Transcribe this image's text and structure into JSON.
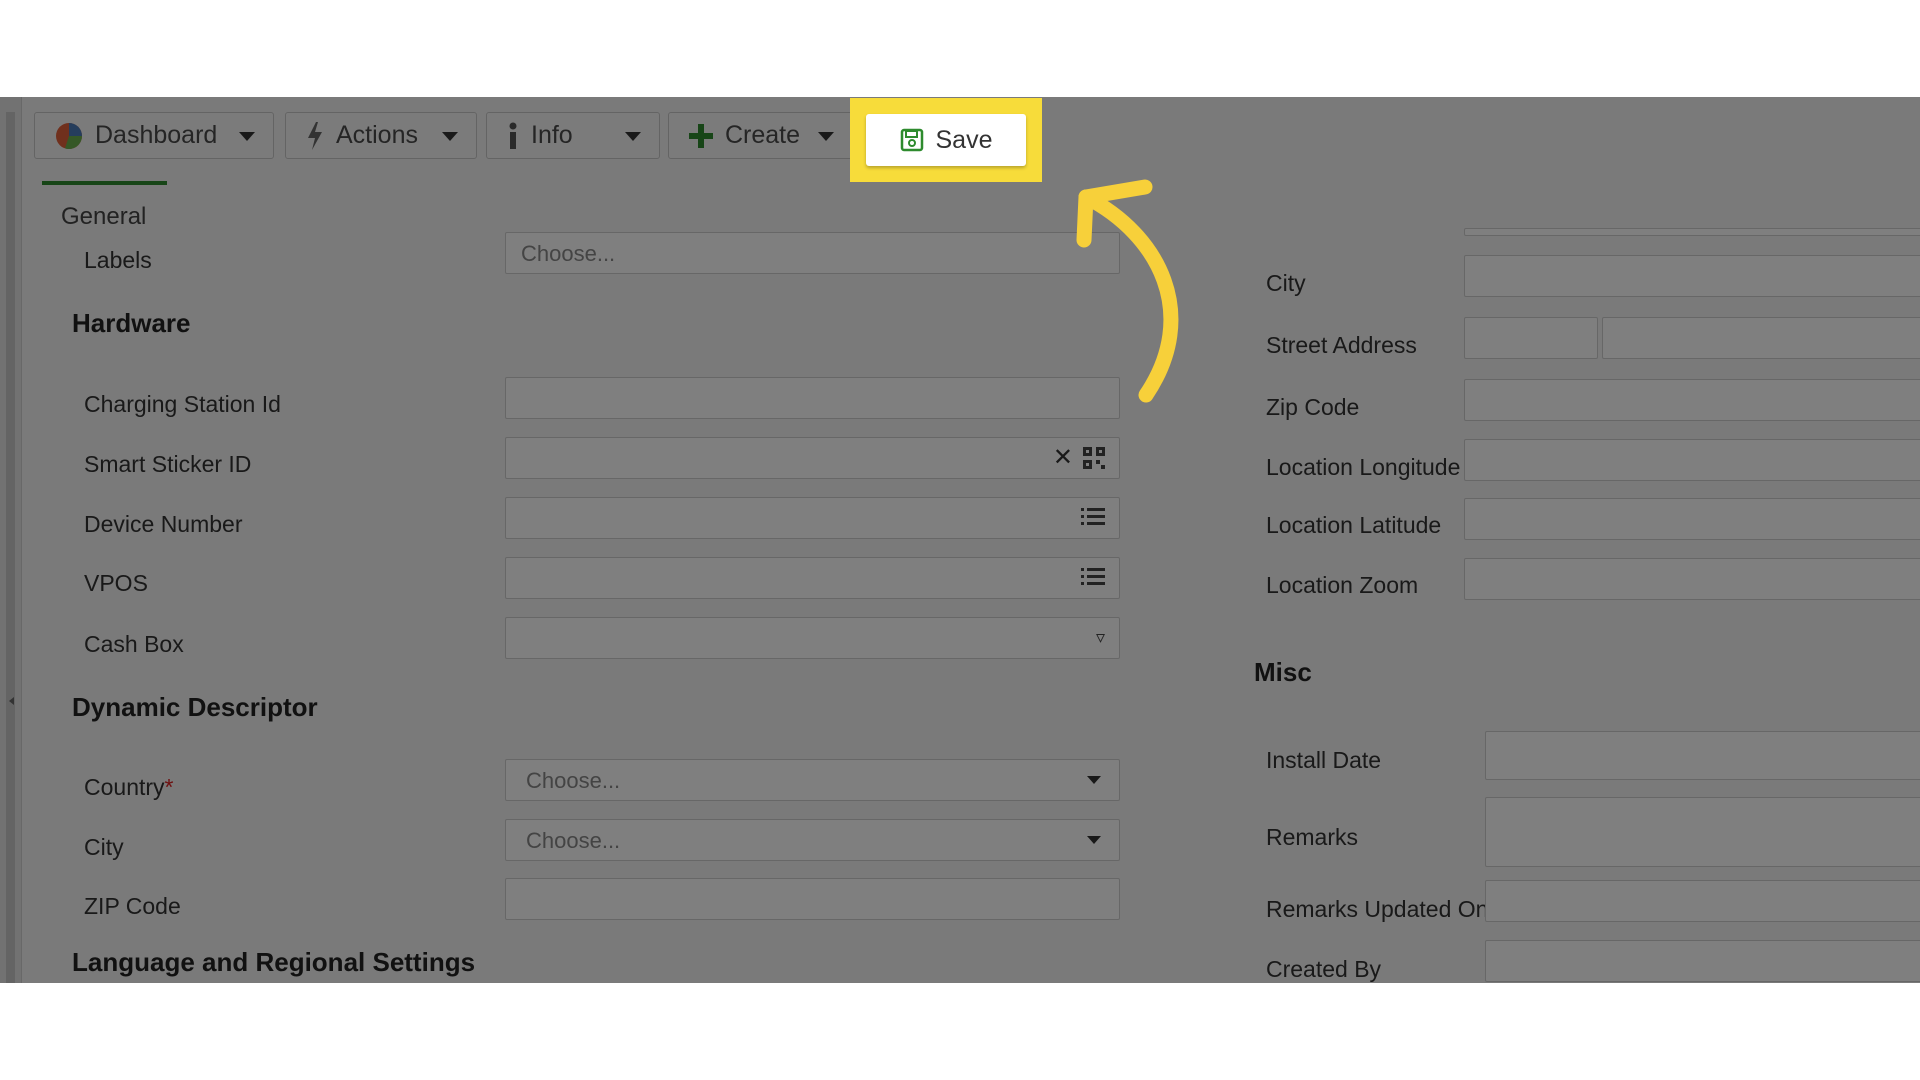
{
  "toolbar": {
    "dashboard_label": "Dashboard",
    "actions_label": "Actions",
    "info_label": "Info",
    "create_label": "Create",
    "save_label": "Save"
  },
  "tabs": {
    "general_label": "General"
  },
  "left": {
    "labels_label": "Labels",
    "labels_placeholder": "Choose...",
    "hardware_title": "Hardware",
    "charging_station_id_label": "Charging Station Id",
    "smart_sticker_id_label": "Smart Sticker ID",
    "device_number_label": "Device Number",
    "vpos_label": "VPOS",
    "cash_box_label": "Cash Box",
    "dynamic_descriptor_title": "Dynamic Descriptor",
    "country_label": "Country",
    "country_required_mark": "*",
    "country_placeholder": "Choose...",
    "city_label": "City",
    "city_placeholder": "Choose...",
    "zip_code_label": "ZIP Code",
    "language_title": "Language and Regional Settings"
  },
  "right": {
    "city_label": "City",
    "street_address_label": "Street Address",
    "zip_code_label": "Zip Code",
    "location_longitude_label": "Location Longitude",
    "location_latitude_label": "Location Latitude",
    "location_zoom_label": "Location Zoom",
    "misc_title": "Misc",
    "install_date_label": "Install Date",
    "remarks_label": "Remarks",
    "remarks_updated_on_label": "Remarks Updated On",
    "created_by_label": "Created By"
  },
  "colors": {
    "highlight": "#f7dc3a",
    "accent_green": "#2e8b2e",
    "dim_overlay": "rgba(0,0,0,0.5)"
  },
  "icons": [
    "pie-chart-icon",
    "bolt-icon",
    "info-icon",
    "plus-icon",
    "save-icon",
    "clear-icon",
    "qr-code-icon",
    "list-icon",
    "caret-down-icon",
    "arrow-pointer"
  ]
}
